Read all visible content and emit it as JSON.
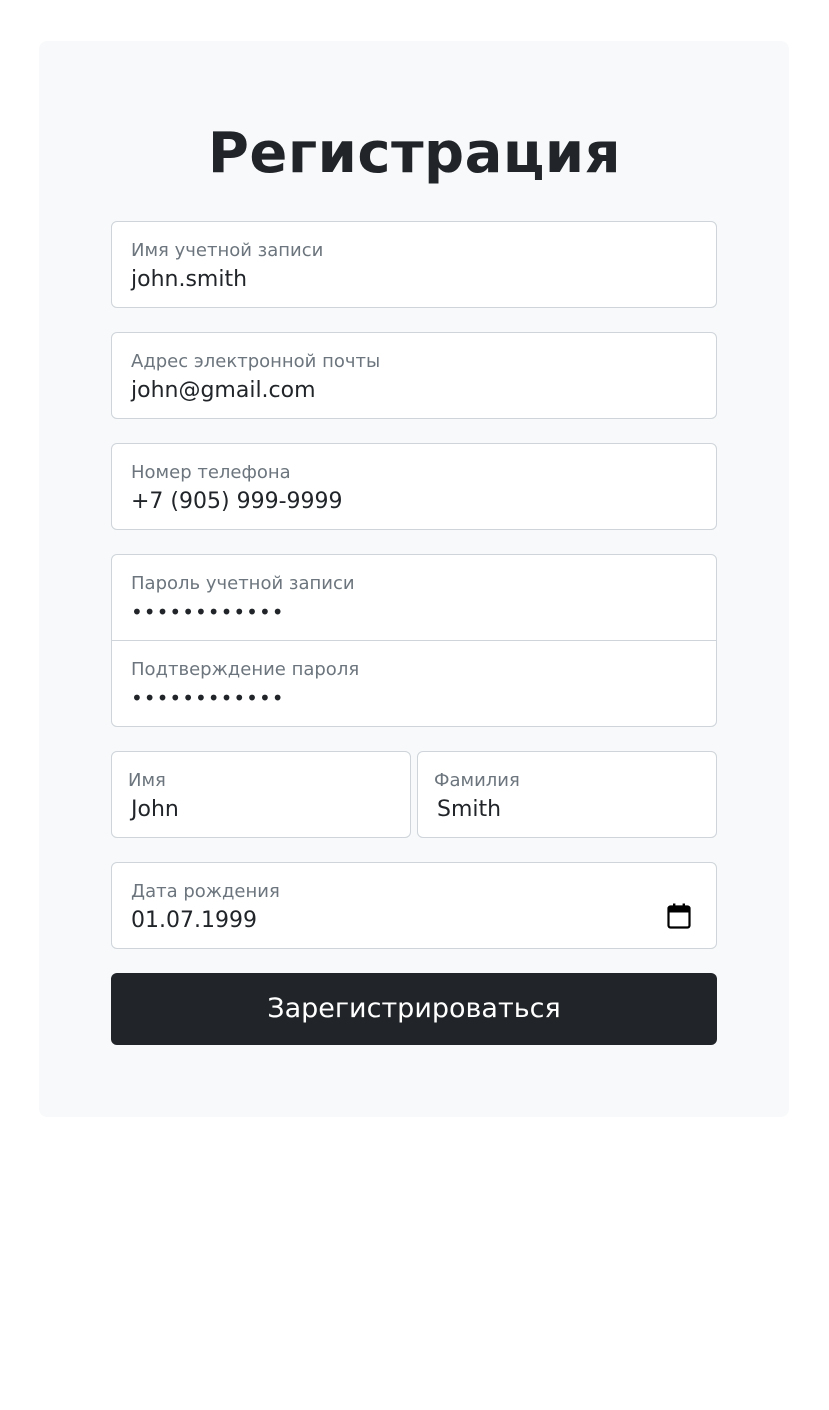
{
  "form": {
    "title": "Регистрация",
    "username": {
      "label": "Имя учетной записи",
      "value": "john.smith"
    },
    "email": {
      "label": "Адрес электронной почты",
      "value": "john@gmail.com"
    },
    "phone": {
      "label": "Номер телефона",
      "value": "+7 (905) 999-9999"
    },
    "password": {
      "label": "Пароль учетной записи",
      "value": "••••••••••••"
    },
    "password_confirm": {
      "label": "Подтверждение пароля",
      "value": "••••••••••••"
    },
    "first_name": {
      "label": "Имя",
      "value": "John"
    },
    "last_name": {
      "label": "Фамилия",
      "value": "Smith"
    },
    "birth_date": {
      "label": "Дата рождения",
      "value": "01.07.1999",
      "icon": "calendar-icon"
    },
    "submit_label": "Зарегистрироваться"
  },
  "colors": {
    "card_background": "#f8f9fa",
    "button_background": "#212529",
    "label_text": "#6c757d",
    "input_border": "#ced4da"
  }
}
